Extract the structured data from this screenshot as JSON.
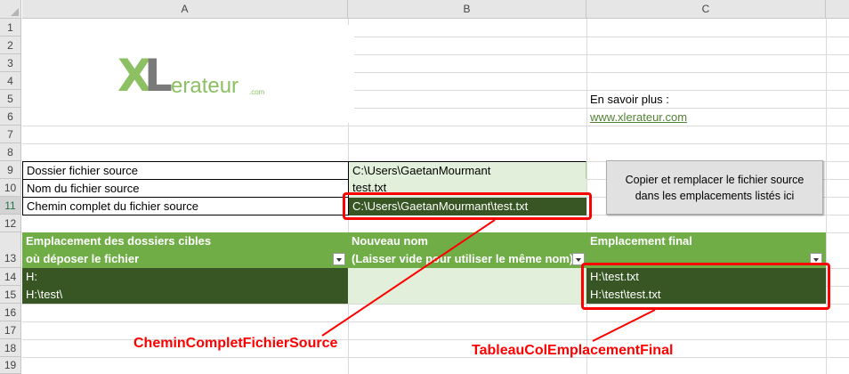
{
  "columns": [
    "A",
    "B",
    "C"
  ],
  "rows": [
    "1",
    "2",
    "3",
    "4",
    "5",
    "6",
    "7",
    "8",
    "9",
    "10",
    "11",
    "12",
    "13",
    "14",
    "15",
    "16",
    "17",
    "18",
    "19"
  ],
  "logo": {
    "x": "X",
    "l": "L",
    "erateur": "erateur",
    "com": ".com"
  },
  "info": {
    "savoir_label": "En savoir plus :",
    "link": "www.xlerateur.com"
  },
  "params": [
    {
      "label": "Dossier fichier source",
      "value": "C:\\Users\\GaetanMourmant"
    },
    {
      "label": "Nom du fichier source",
      "value": "test.txt"
    },
    {
      "label": "Chemin complet du fichier source",
      "value": "C:\\Users\\GaetanMourmant\\test.txt"
    }
  ],
  "button": {
    "line1": "Copier et remplacer le fichier source",
    "line2": "dans les emplacements listés ici"
  },
  "table": {
    "headers": [
      {
        "line1": "Emplacement des dossiers cibles",
        "line2": "où déposer le fichier"
      },
      {
        "line1": "Nouveau nom",
        "line2": "(Laisser vide pour utiliser le même nom)"
      },
      {
        "line1": "",
        "line2": "Emplacement final"
      }
    ],
    "rows": [
      {
        "dossier": "H:",
        "nom": "",
        "final": "H:\\test.txt"
      },
      {
        "dossier": "H:\\test\\",
        "nom": "",
        "final": "H:\\test\\test.txt"
      }
    ]
  },
  "annotations": {
    "chemin": "CheminCompletFichierSource",
    "tableau": "TableauColEmplacementFinal"
  },
  "colors": {
    "accent": "#70ad47",
    "dark": "#375623",
    "light": "#e2efda",
    "annotation": "#ff0000"
  }
}
